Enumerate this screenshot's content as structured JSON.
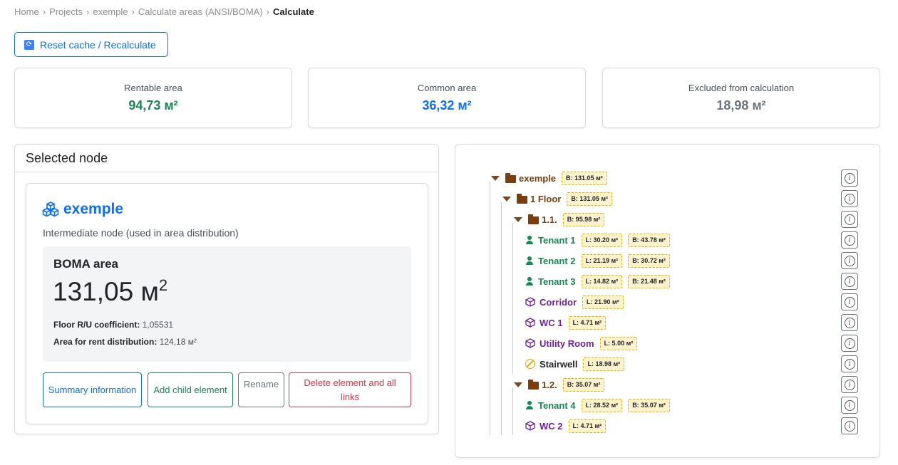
{
  "breadcrumb": {
    "items": [
      "Home",
      "Projects",
      "exemple",
      "Calculate areas (ANSI/BOMA)"
    ],
    "current": "Calculate"
  },
  "reset_button": {
    "label": "Reset cache / Recalculate",
    "icon": "refresh-icon"
  },
  "stats": {
    "rentable": {
      "label": "Rentable area",
      "value": "94,73 м²"
    },
    "common": {
      "label": "Common area",
      "value": "36,32 м²"
    },
    "excluded": {
      "label": "Excluded from calculation",
      "value": "18,98 м²"
    }
  },
  "selected_node": {
    "header": "Selected node",
    "title": "exemple",
    "subtitle": "Intermediate node (used in area distribution)",
    "boma_title": "BOMA area",
    "boma_value": "131,05 м",
    "boma_unit_sup": "2",
    "ru_label": "Floor R/U coefficient:",
    "ru_value": "1,05531",
    "rent_label": "Area for rent distribution:",
    "rent_value": "124,18 м²",
    "buttons": {
      "summary": "Summary information",
      "add_child": "Add child element",
      "rename": "Rename",
      "delete": "Delete element and all links"
    }
  },
  "tree": [
    {
      "label": "exemple",
      "type": "folder",
      "badges": [
        "B: 131.05 м²"
      ]
    },
    {
      "label": "1 Floor",
      "type": "folder",
      "badges": [
        "B: 131.05 м²"
      ]
    },
    {
      "label": "1.1.",
      "type": "folder",
      "badges": [
        "B: 95.98 м²"
      ]
    },
    {
      "label": "Tenant 1",
      "type": "tenant",
      "badges": [
        "L: 30.20 м²",
        "B: 43.78 м²"
      ]
    },
    {
      "label": "Tenant 2",
      "type": "tenant",
      "badges": [
        "L: 21.19 м²",
        "B: 30.72 м²"
      ]
    },
    {
      "label": "Tenant 3",
      "type": "tenant",
      "badges": [
        "L: 14.82 м²",
        "B: 21.48 м²"
      ]
    },
    {
      "label": "Corridor",
      "type": "common",
      "badges": [
        "L: 21.90 м²"
      ]
    },
    {
      "label": "WC 1",
      "type": "common",
      "badges": [
        "L: 4.71 м²"
      ]
    },
    {
      "label": "Utility Room",
      "type": "common",
      "badges": [
        "L: 5.00 м²"
      ]
    },
    {
      "label": "Stairwell",
      "type": "excluded",
      "badges": [
        "L: 18.98 м²"
      ]
    },
    {
      "label": "1.2.",
      "type": "folder",
      "badges": [
        "B: 35.07 м²"
      ]
    },
    {
      "label": "Tenant 4",
      "type": "tenant",
      "badges": [
        "L: 28.52 м²",
        "B: 35.07 м²"
      ]
    },
    {
      "label": "WC 2",
      "type": "common",
      "badges": [
        "L: 4.71 м²"
      ]
    }
  ],
  "info_icon": "i",
  "colors": {
    "primary": "#0d6efd",
    "success": "#198754",
    "secondary": "#6c757d",
    "danger": "#dc3545",
    "folder": "#7a3d0c",
    "common": "#6f1fa0",
    "excluded": "#e0a800"
  }
}
